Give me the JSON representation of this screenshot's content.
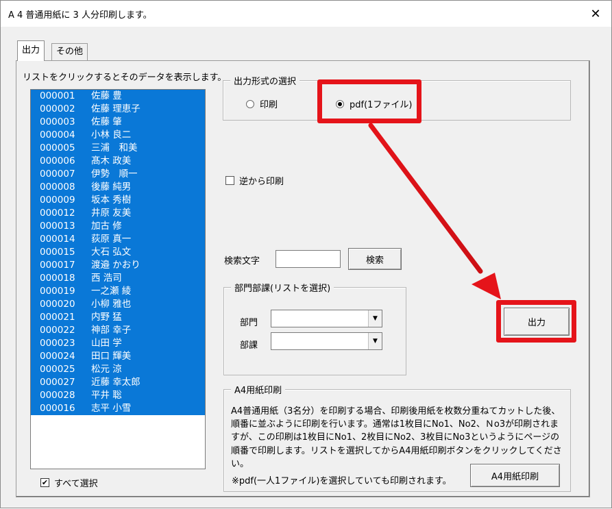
{
  "window": {
    "title": "A 4 普通用紙に 3 人分印刷します。",
    "close_glyph": "✕"
  },
  "tabs": [
    {
      "label": "出力",
      "selected": true
    },
    {
      "label": "その他",
      "selected": false
    }
  ],
  "list": {
    "caption": "リストをクリックするとそのデータを表示します。",
    "rows": [
      {
        "code": "000001",
        "name": "佐藤 豊"
      },
      {
        "code": "000002",
        "name": "佐藤 理恵子"
      },
      {
        "code": "000003",
        "name": "佐藤 肇"
      },
      {
        "code": "000004",
        "name": "小林 良二"
      },
      {
        "code": "000005",
        "name": "三浦　和美"
      },
      {
        "code": "000006",
        "name": "髙木 政美"
      },
      {
        "code": "000007",
        "name": "伊勢　順一"
      },
      {
        "code": "000008",
        "name": "後藤 純男"
      },
      {
        "code": "000009",
        "name": "坂本 秀樹"
      },
      {
        "code": "000012",
        "name": "井原 友美"
      },
      {
        "code": "000013",
        "name": "加古 修"
      },
      {
        "code": "000014",
        "name": "荻原 真一"
      },
      {
        "code": "000015",
        "name": "大石 弘文"
      },
      {
        "code": "000017",
        "name": "渡邉 かおり"
      },
      {
        "code": "000018",
        "name": "西 浩司"
      },
      {
        "code": "000019",
        "name": "一之瀬 綾"
      },
      {
        "code": "000020",
        "name": "小柳 雅也"
      },
      {
        "code": "000021",
        "name": "内野 猛"
      },
      {
        "code": "000022",
        "name": "神部 幸子"
      },
      {
        "code": "000023",
        "name": "山田 学"
      },
      {
        "code": "000024",
        "name": "田口 輝美"
      },
      {
        "code": "000025",
        "name": "松元 涼"
      },
      {
        "code": "000027",
        "name": "近藤 幸太郎"
      },
      {
        "code": "000028",
        "name": "平井 聡"
      },
      {
        "code": "000016",
        "name": "志平 小雪"
      }
    ],
    "select_all": {
      "label": "すべて選択",
      "checked": true,
      "check_glyph": "✔"
    }
  },
  "output_format": {
    "legend": "出力形式の選択",
    "options": [
      {
        "label": "印刷",
        "checked": false
      },
      {
        "label": "pdf(1ファイル)",
        "checked": true
      }
    ]
  },
  "reverse_print": {
    "label": "逆から印刷",
    "checked": false
  },
  "search": {
    "label": "検索文字",
    "value": "",
    "button_label": "検索"
  },
  "department": {
    "legend": "部門部課(リストを選択)",
    "division_label": "部門",
    "division_value": "",
    "section_label": "部課",
    "section_value": "",
    "arrow_glyph": "▼"
  },
  "output_button_label": "出力",
  "a4_print": {
    "legend": "A4用紙印刷",
    "description": "A4普通用紙（3名分）を印刷する場合、印刷後用紙を枚数分重ねてカットした後、順番に並ぶように印刷を行います。通常は1枚目にNo1、No2、Ｎo3が印刷されますが、この印刷は1枚目にNo1、2枚目にNo2、3枚目にNo3というようにページの順番で印刷します。リストを選択してからA4用紙印刷ボタンをクリックしてください。",
    "note": "※pdf(一人1ファイル)を選択していても印刷されます。",
    "button_label": "A4用紙印刷"
  },
  "colors": {
    "selection": "#0a78d7",
    "annotation_red": "#e5141a"
  }
}
